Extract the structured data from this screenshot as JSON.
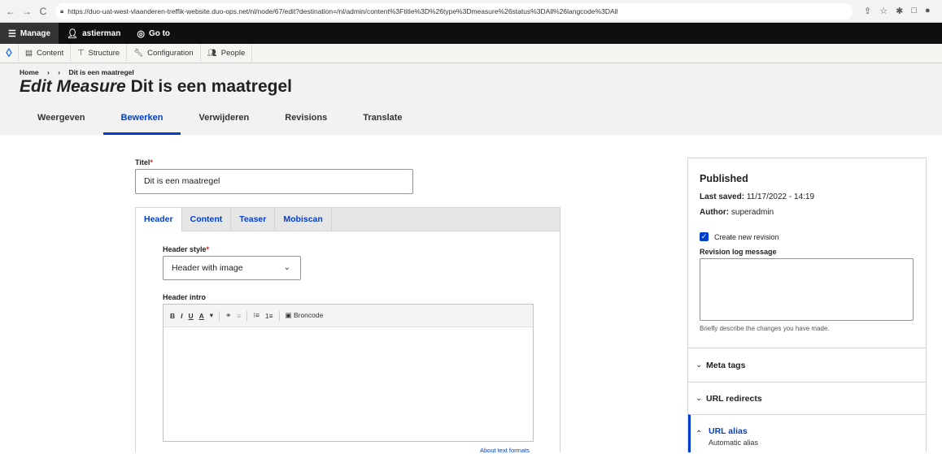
{
  "browser": {
    "url": "https://duo-uat-west-vlaanderen-treffik-website.duo-ops.net/nl/node/67/edit?destination=/nl/admin/content%3Ftitle%3D%26type%3Dmeasure%26status%3DAll%26langcode%3DAll"
  },
  "toolbar": {
    "manage": "Manage",
    "user": "astierman",
    "goto": "Go to"
  },
  "tray": {
    "items": [
      "Content",
      "Structure",
      "Configuration",
      "People"
    ]
  },
  "breadcrumb": {
    "home": "Home",
    "sep1": "›",
    "sep2": "›",
    "current": "Dit is een maatregel"
  },
  "page": {
    "title_type": "Edit Measure",
    "title_name": "Dit is een maatregel"
  },
  "tabs": [
    "Weergeven",
    "Bewerken",
    "Verwijderen",
    "Revisions",
    "Translate"
  ],
  "form": {
    "titel_label": "Titel",
    "titel_value": "Dit is een maatregel",
    "vtabs": [
      "Header",
      "Content",
      "Teaser",
      "Mobiscan"
    ],
    "header_style_label": "Header style",
    "header_style_value": "Header with image",
    "header_intro_label": "Header intro",
    "editor_buttons": [
      "B",
      "I",
      "U",
      "A",
      "▾",
      "⚭",
      "≡",
      "⁝≡",
      "1≡",
      "Broncode"
    ],
    "about_formats": "About text formats"
  },
  "sidebar": {
    "status": "Published",
    "last_saved_label": "Last saved:",
    "last_saved_value": "11/17/2022 - 14:19",
    "author_label": "Author:",
    "author_value": "superadmin",
    "create_revision": "Create new revision",
    "revision_log_label": "Revision log message",
    "revision_hint": "Briefly describe the changes you have made.",
    "meta_tags": "Meta tags",
    "url_redirects": "URL redirects",
    "url_alias": "URL alias",
    "url_alias_sub": "Automatic alias"
  }
}
